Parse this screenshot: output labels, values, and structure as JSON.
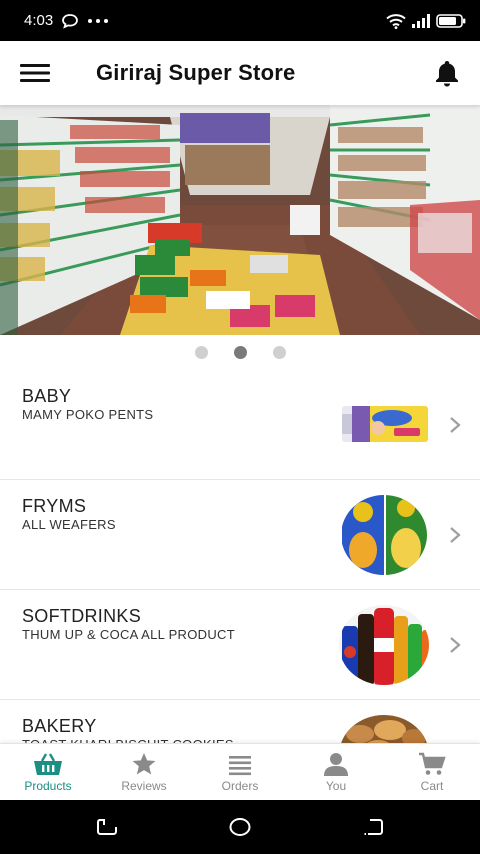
{
  "status_bar": {
    "time": "4:03"
  },
  "header": {
    "title": "Giriraj Super Store"
  },
  "banner": {
    "slide_count": 3,
    "active_slide": 2
  },
  "categories": [
    {
      "name": "BABY",
      "subtitle": "MAMY POKO PENTS",
      "thumb_icon": "diaper-pack-icon"
    },
    {
      "name": "FRYMS",
      "subtitle": "ALL WEAFERS",
      "thumb_icon": "chips-packets-icon"
    },
    {
      "name": "SOFTDRINKS",
      "subtitle": "THUM UP & COCA ALL PRODUCT",
      "thumb_icon": "soft-drink-bottles-icon"
    },
    {
      "name": "BAKERY",
      "subtitle": "TOAST KHARI BISCUIT COOKIES",
      "thumb_icon": "bakery-items-icon"
    }
  ],
  "bottom_nav": [
    {
      "label": "Products",
      "icon": "basket-icon",
      "active": true
    },
    {
      "label": "Reviews",
      "icon": "star-icon",
      "active": false
    },
    {
      "label": "Orders",
      "icon": "list-icon",
      "active": false
    },
    {
      "label": "You",
      "icon": "person-icon",
      "active": false
    },
    {
      "label": "Cart",
      "icon": "cart-icon",
      "active": false
    }
  ],
  "colors": {
    "accent": "#1b8f84",
    "inactive": "#8a8a8a",
    "status_bar": "#000000"
  }
}
